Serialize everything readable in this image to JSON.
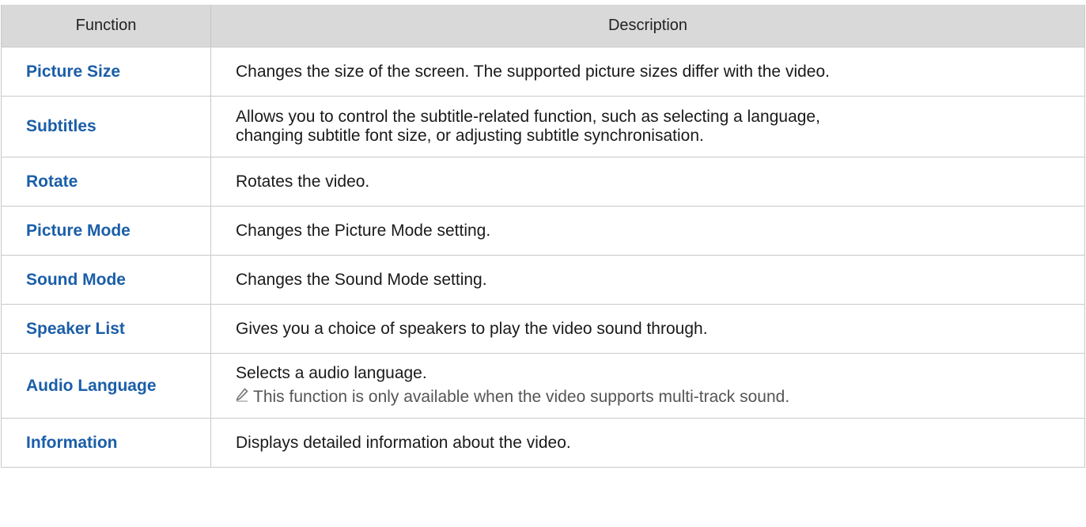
{
  "table": {
    "headers": {
      "function": "Function",
      "description": "Description"
    },
    "rows": [
      {
        "function": "Picture Size",
        "description": "Changes the size of the screen. The supported picture sizes differ with the video."
      },
      {
        "function": "Subtitles",
        "description_line1": "Allows you to control the subtitle-related function, such as selecting a language,",
        "description_line2": "changing subtitle font size, or adjusting subtitle synchronisation."
      },
      {
        "function": "Rotate",
        "description": "Rotates the video."
      },
      {
        "function": "Picture Mode",
        "description": "Changes the Picture Mode setting."
      },
      {
        "function": "Sound Mode",
        "description": "Changes the Sound Mode setting."
      },
      {
        "function": "Speaker List",
        "description": "Gives you a choice of speakers to play the video sound through."
      },
      {
        "function": "Audio Language",
        "description": "Selects a audio language.",
        "note": "This function is only available when the video supports multi-track sound.",
        "note_icon": "pencil-icon"
      },
      {
        "function": "Information",
        "description": "Displays detailed information about the video."
      }
    ]
  },
  "colors": {
    "function_text": "#1a5ea8",
    "header_bg": "#d9d9d9",
    "border": "#c9c9c9"
  }
}
